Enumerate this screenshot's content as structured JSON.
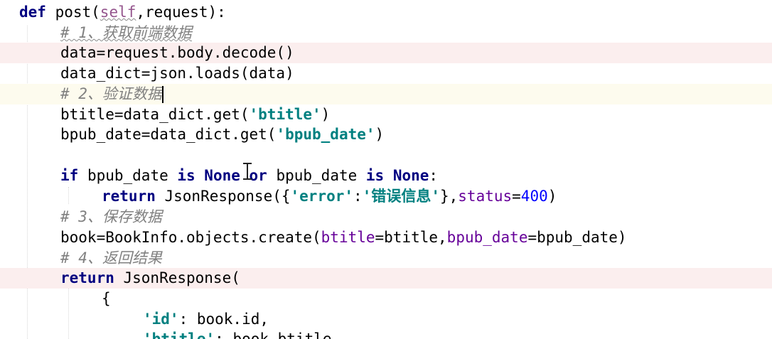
{
  "editor": {
    "lines": [
      {
        "tokens": [
          {
            "t": "kw",
            "v": "def"
          },
          {
            "t": "plain",
            "v": " post("
          },
          {
            "t": "self",
            "v": "self"
          },
          {
            "t": "plain",
            "v": ",request):"
          }
        ]
      },
      {
        "tokens": [
          {
            "t": "cmt",
            "v": "# 1、获取前端数据"
          }
        ]
      },
      {
        "tokens": [
          {
            "t": "plain",
            "v": "data=request.body.decode()"
          }
        ]
      },
      {
        "tokens": [
          {
            "t": "plain",
            "v": "data_dict=json.loads(data)"
          }
        ]
      },
      {
        "tokens": [
          {
            "t": "cmt",
            "v": "# 2、验证数据"
          }
        ]
      },
      {
        "tokens": [
          {
            "t": "plain",
            "v": "btitle=data_dict.get("
          },
          {
            "t": "str",
            "v": "'btitle'"
          },
          {
            "t": "plain",
            "v": ")"
          }
        ]
      },
      {
        "tokens": [
          {
            "t": "plain",
            "v": "bpub_date=data_dict.get("
          },
          {
            "t": "str",
            "v": "'bpub_date'"
          },
          {
            "t": "plain",
            "v": ")"
          }
        ]
      },
      {
        "tokens": []
      },
      {
        "tokens": [
          {
            "t": "kw",
            "v": "if"
          },
          {
            "t": "plain",
            "v": " bpub_date "
          },
          {
            "t": "kw",
            "v": "is None or"
          },
          {
            "t": "plain",
            "v": " bpub_date "
          },
          {
            "t": "kw",
            "v": "is None"
          },
          {
            "t": "plain",
            "v": ":"
          }
        ]
      },
      {
        "tokens": [
          {
            "t": "kw",
            "v": "return"
          },
          {
            "t": "plain",
            "v": " JsonResponse({"
          },
          {
            "t": "str",
            "v": "'error'"
          },
          {
            "t": "plain",
            "v": ":"
          },
          {
            "t": "str",
            "v": "'错误信息'"
          },
          {
            "t": "plain",
            "v": "},"
          },
          {
            "t": "kwarg",
            "v": "status"
          },
          {
            "t": "plain",
            "v": "="
          },
          {
            "t": "num",
            "v": "400"
          },
          {
            "t": "plain",
            "v": ")"
          }
        ]
      },
      {
        "tokens": [
          {
            "t": "cmt",
            "v": "# 3、保存数据"
          }
        ]
      },
      {
        "tokens": [
          {
            "t": "plain",
            "v": "book=BookInfo.objects.create("
          },
          {
            "t": "kwarg",
            "v": "btitle"
          },
          {
            "t": "plain",
            "v": "=btitle,"
          },
          {
            "t": "kwarg",
            "v": "bpub_date"
          },
          {
            "t": "plain",
            "v": "=bpub_date)"
          }
        ]
      },
      {
        "tokens": [
          {
            "t": "cmt",
            "v": "# 4、返回结果"
          }
        ]
      },
      {
        "tokens": [
          {
            "t": "kw",
            "v": "return"
          },
          {
            "t": "plain",
            "v": " JsonResponse("
          }
        ]
      },
      {
        "tokens": [
          {
            "t": "plain",
            "v": "{"
          }
        ]
      },
      {
        "tokens": [
          {
            "t": "str",
            "v": "'id'"
          },
          {
            "t": "plain",
            "v": ": book.id,"
          }
        ]
      },
      {
        "tokens": [
          {
            "t": "str",
            "v": "'btitle'"
          },
          {
            "t": "plain",
            "v": ": book.btitle,"
          }
        ]
      }
    ]
  }
}
